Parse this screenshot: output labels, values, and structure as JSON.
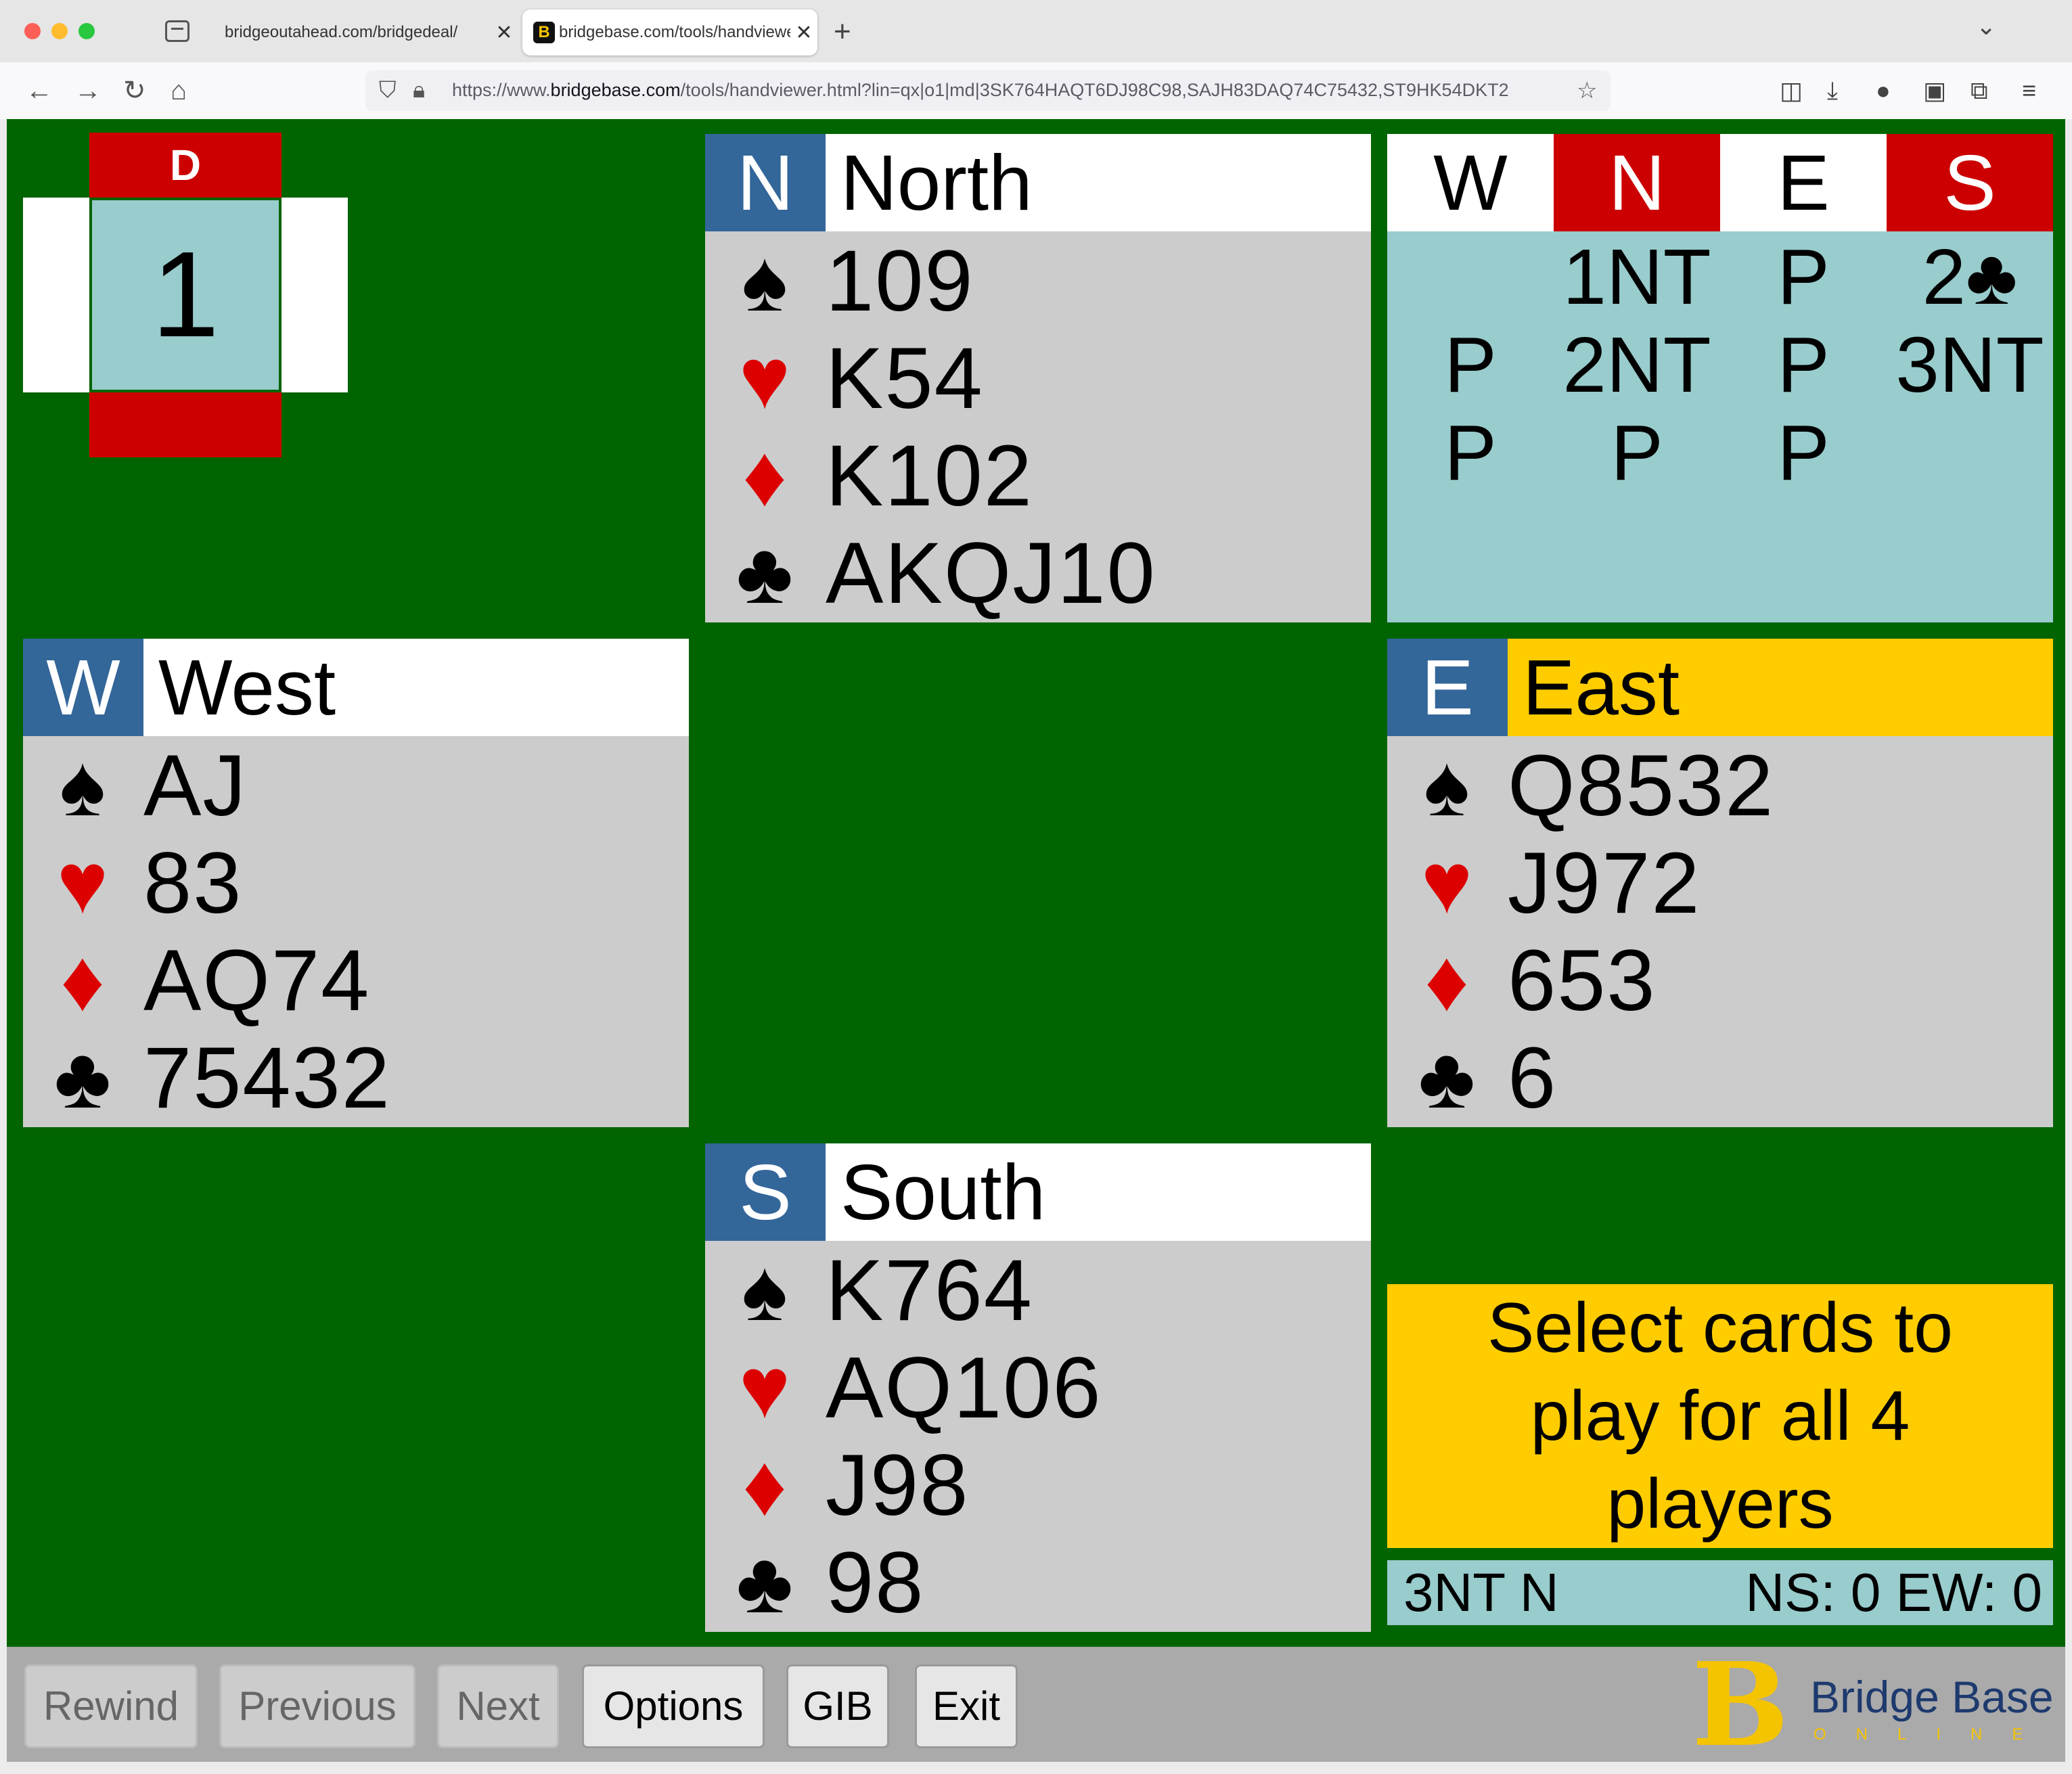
{
  "browser": {
    "tabs": [
      {
        "title": "bridgeoutahead.com/bridgedeal/",
        "active": false
      },
      {
        "title": "bridgebase.com/tools/handviewe",
        "active": true
      }
    ],
    "url_prefix": "https://www.",
    "url_host": "bridgebase.com",
    "url_rest": "/tools/handviewer.html?lin=qx|o1|md|3SK764HAQT6DJ98C98,SAJH83DAQ74C75432,ST9HK54DKT2"
  },
  "board": {
    "dealer_label": "D",
    "number": "1"
  },
  "suits": {
    "spades": "♠",
    "hearts": "♥",
    "diamonds": "♦",
    "clubs": "♣"
  },
  "hands": {
    "north": {
      "dir": "N",
      "name": "North",
      "spades": "109",
      "hearts": "K54",
      "diamonds": "K102",
      "clubs": "AKQJ10"
    },
    "west": {
      "dir": "W",
      "name": "West",
      "spades": "AJ",
      "hearts": "83",
      "diamonds": "AQ74",
      "clubs": "75432"
    },
    "east": {
      "dir": "E",
      "name": "East",
      "spades": "Q8532",
      "hearts": "J972",
      "diamonds": "653",
      "clubs": "6"
    },
    "south": {
      "dir": "S",
      "name": "South",
      "spades": "K764",
      "hearts": "AQ106",
      "diamonds": "J98",
      "clubs": "98"
    }
  },
  "auction": {
    "headers": [
      "W",
      "N",
      "E",
      "S"
    ],
    "bids": [
      [
        "",
        "1NT",
        "P",
        "2♣"
      ],
      [
        "P",
        "2NT",
        "P",
        "3NT"
      ],
      [
        "P",
        "P",
        "P",
        ""
      ]
    ]
  },
  "message": "Select cards to play for all 4 players",
  "status": {
    "contract": "3NT N",
    "score": "NS: 0 EW: 0"
  },
  "toolbar": {
    "rewind": "Rewind",
    "previous": "Previous",
    "next": "Next",
    "options": "Options",
    "gib": "GIB",
    "exit": "Exit"
  },
  "logo": {
    "mark": "B",
    "name": "Bridge Base",
    "sub": "ONLINE"
  },
  "colors": {
    "table_green": "#006400",
    "vulnerable_red": "#cc0000",
    "panel_teal": "#99cccc",
    "highlight_yellow": "#ffcc00",
    "direction_blue": "#336699"
  }
}
